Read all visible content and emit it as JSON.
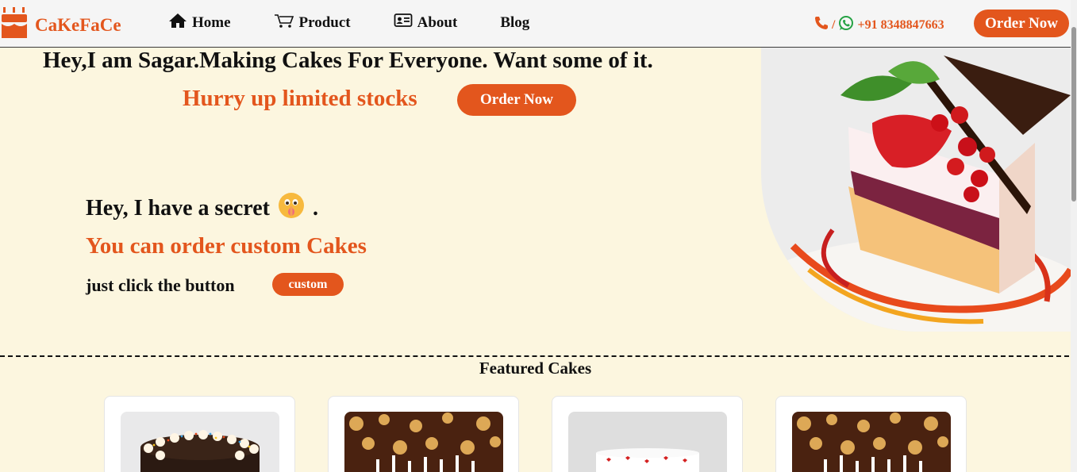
{
  "nav": {
    "brand": "CaKeFaCe",
    "brand_icon": "cake-icon",
    "links": [
      {
        "label": "Home",
        "icon": "home-icon"
      },
      {
        "label": "Product",
        "icon": "cart-icon"
      },
      {
        "label": "About",
        "icon": "id-card-icon"
      },
      {
        "label": "Blog",
        "icon": ""
      }
    ],
    "contact_separator": "/",
    "phone": "+91 8348847663",
    "order_button": "Order Now"
  },
  "hero": {
    "title": "Hey,I am Sagar.Making Cakes For Everyone. Want some of it.",
    "hurry": "Hurry up limited stocks",
    "order_button": "Order Now",
    "secret": "Hey, I have a secret",
    "secret_end": ".",
    "custom_cakes": "You can order custom Cakes",
    "click_text": "just click the button",
    "custom_button": "custom"
  },
  "featured": {
    "title": "Featured Cakes",
    "cards": [
      {
        "image": "chocolate-sprinkle-cake"
      },
      {
        "image": "birthday-candles-cake"
      },
      {
        "image": "white-heart-cake"
      },
      {
        "image": "birthday-candles-cake"
      }
    ]
  },
  "colors": {
    "accent": "#e3561d",
    "background": "#fcf6df",
    "nav_bg": "#f5f5f5",
    "whatsapp": "#25a244"
  }
}
